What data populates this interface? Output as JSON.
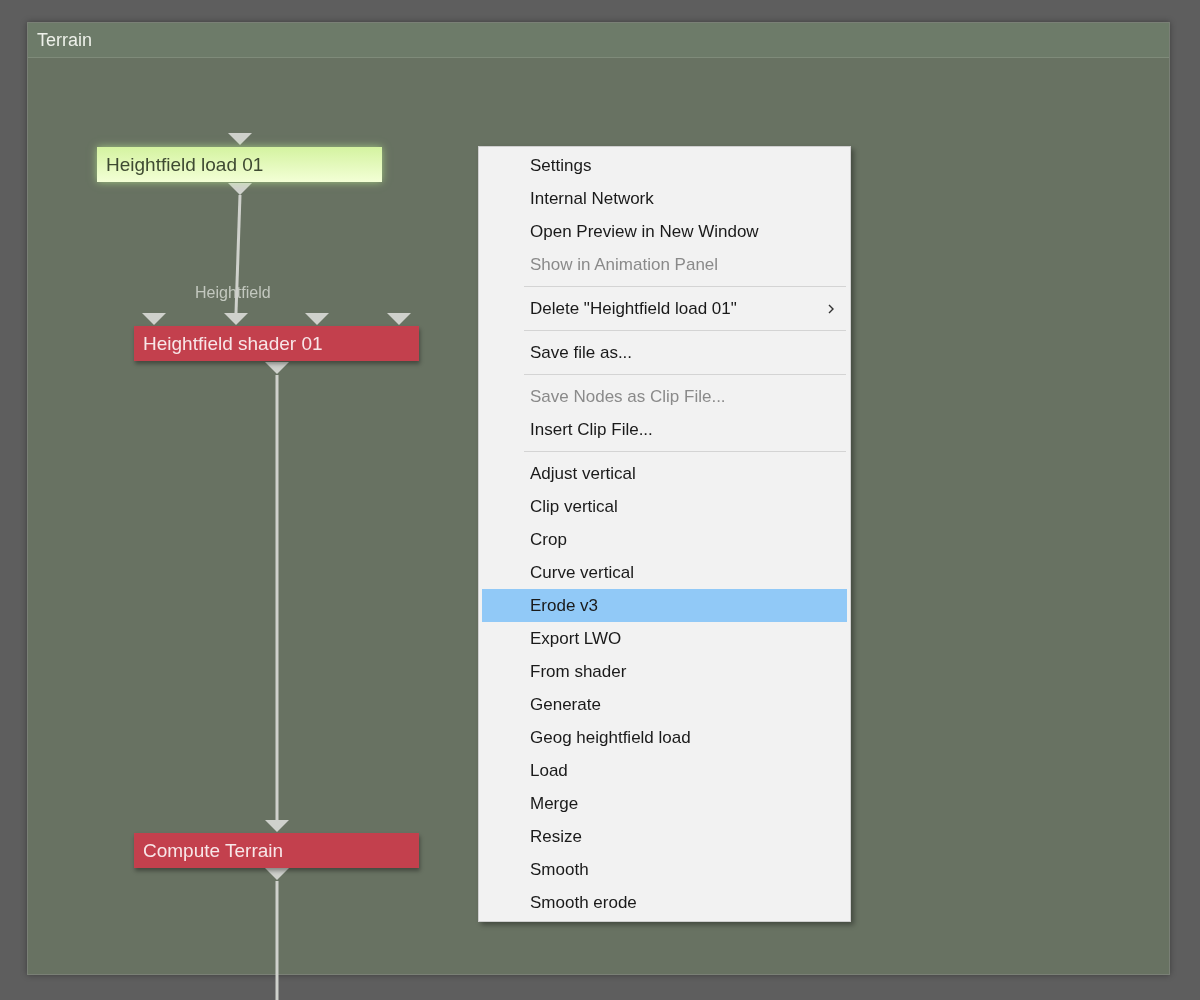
{
  "window": {
    "title": "Terrain"
  },
  "nodes": [
    {
      "label": "Heightfield load 01",
      "selected": true
    },
    {
      "label": "Heightfield shader 01",
      "selected": false
    },
    {
      "label": "Compute Terrain",
      "selected": false
    }
  ],
  "port_label": "Heightfield",
  "context_menu": {
    "groups": [
      [
        {
          "label": "Settings",
          "disabled": false,
          "selected": false,
          "submenu": false
        },
        {
          "label": "Internal Network",
          "disabled": false,
          "selected": false,
          "submenu": false
        },
        {
          "label": "Open Preview in New Window",
          "disabled": false,
          "selected": false,
          "submenu": false
        },
        {
          "label": "Show in Animation Panel",
          "disabled": true,
          "selected": false,
          "submenu": false
        }
      ],
      [
        {
          "label": "Delete \"Heightfield load 01\"",
          "disabled": false,
          "selected": false,
          "submenu": true
        }
      ],
      [
        {
          "label": "Save file as...",
          "disabled": false,
          "selected": false,
          "submenu": false
        }
      ],
      [
        {
          "label": "Save Nodes as Clip File...",
          "disabled": true,
          "selected": false,
          "submenu": false
        },
        {
          "label": "Insert Clip File...",
          "disabled": false,
          "selected": false,
          "submenu": false
        }
      ],
      [
        {
          "label": "Adjust vertical",
          "disabled": false,
          "selected": false,
          "submenu": false
        },
        {
          "label": "Clip vertical",
          "disabled": false,
          "selected": false,
          "submenu": false
        },
        {
          "label": "Crop",
          "disabled": false,
          "selected": false,
          "submenu": false
        },
        {
          "label": "Curve vertical",
          "disabled": false,
          "selected": false,
          "submenu": false
        },
        {
          "label": "Erode v3",
          "disabled": false,
          "selected": true,
          "submenu": false
        },
        {
          "label": "Export LWO",
          "disabled": false,
          "selected": false,
          "submenu": false
        },
        {
          "label": "From shader",
          "disabled": false,
          "selected": false,
          "submenu": false
        },
        {
          "label": "Generate",
          "disabled": false,
          "selected": false,
          "submenu": false
        },
        {
          "label": "Geog heightfield load",
          "disabled": false,
          "selected": false,
          "submenu": false
        },
        {
          "label": "Load",
          "disabled": false,
          "selected": false,
          "submenu": false
        },
        {
          "label": "Merge",
          "disabled": false,
          "selected": false,
          "submenu": false
        },
        {
          "label": "Resize",
          "disabled": false,
          "selected": false,
          "submenu": false
        },
        {
          "label": "Smooth",
          "disabled": false,
          "selected": false,
          "submenu": false
        },
        {
          "label": "Smooth erode",
          "disabled": false,
          "selected": false,
          "submenu": false
        }
      ]
    ]
  }
}
